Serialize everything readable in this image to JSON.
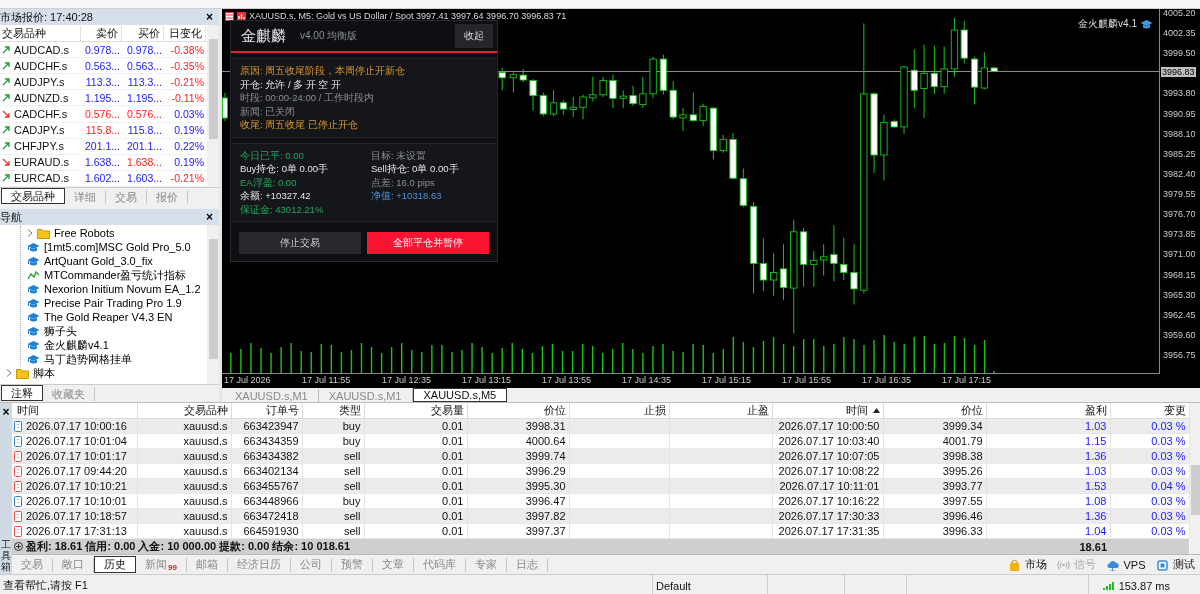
{
  "market_watch": {
    "title": "市场报价: 17:40:28",
    "close_button": "×",
    "columns": [
      "交易品种",
      "卖价",
      "买价",
      "日变化"
    ],
    "rows": [
      {
        "symbol": "AUDCAD.s",
        "direction_up": true,
        "bid": "0.978...",
        "bid_up": true,
        "ask": "0.978...",
        "ask_up": true,
        "change": "-0.38%",
        "change_up": false
      },
      {
        "symbol": "AUDCHF.s",
        "direction_up": true,
        "bid": "0.563...",
        "bid_up": true,
        "ask": "0.563...",
        "ask_up": true,
        "change": "-0.35%",
        "change_up": false
      },
      {
        "symbol": "AUDJPY.s",
        "direction_up": true,
        "bid": "113.3...",
        "bid_up": true,
        "ask": "113.3...",
        "ask_up": true,
        "change": "-0.21%",
        "change_up": false
      },
      {
        "symbol": "AUDNZD.s",
        "direction_up": true,
        "bid": "1.195...",
        "bid_up": true,
        "ask": "1.195...",
        "ask_up": true,
        "change": "-0.11%",
        "change_up": false
      },
      {
        "symbol": "CADCHF.s",
        "direction_up": false,
        "bid": "0.576...",
        "bid_up": false,
        "ask": "0.576...",
        "ask_up": false,
        "change": "0.03%",
        "change_up": true
      },
      {
        "symbol": "CADJPY.s",
        "direction_up": true,
        "bid": "115.8...",
        "bid_up": false,
        "ask": "115.8...",
        "ask_up": true,
        "change": "0.19%",
        "change_up": true
      },
      {
        "symbol": "CHFJPY.s",
        "direction_up": true,
        "bid": "201.1...",
        "bid_up": true,
        "ask": "201.1...",
        "ask_up": true,
        "change": "0.22%",
        "change_up": true
      },
      {
        "symbol": "EURAUD.s",
        "direction_up": false,
        "bid": "1.638...",
        "bid_up": true,
        "ask": "1.638...",
        "ask_up": false,
        "change": "0.19%",
        "change_up": true
      },
      {
        "symbol": "EURCAD.s",
        "direction_up": true,
        "bid": "1.602...",
        "bid_up": true,
        "ask": "1.603...",
        "ask_up": true,
        "change": "-0.21%",
        "change_up": false
      }
    ],
    "tabs": [
      {
        "label": "交易品种",
        "selected": true
      },
      {
        "label": "详细",
        "selected": false
      },
      {
        "label": "交易",
        "selected": false
      },
      {
        "label": "报价",
        "selected": false
      }
    ]
  },
  "navigator": {
    "title": "导航",
    "close_button": "×",
    "tree": [
      {
        "kind": "group",
        "children": [
          {
            "kind": "folder",
            "label": "Free Robots",
            "expanded": false
          },
          {
            "kind": "expert",
            "label": "[1mt5.com]MSC Gold Pro_5.0"
          },
          {
            "kind": "expert",
            "label": "ArtQuant Gold_3.0_fix"
          },
          {
            "kind": "indicator",
            "label": "MTCommander盈亏统计指标"
          },
          {
            "kind": "expert",
            "label": "Nexorion Initium Novum EA_1.2"
          },
          {
            "kind": "expert",
            "label": "Precise Pair Trading Pro 1.9"
          },
          {
            "kind": "expert",
            "label": "The Gold Reaper V4.3 EN"
          },
          {
            "kind": "expert",
            "label": "狮子头"
          },
          {
            "kind": "expert",
            "label": "金火麒麟v4.1"
          },
          {
            "kind": "expert",
            "label": "马丁趋势网格挂单"
          }
        ]
      },
      {
        "kind": "folder",
        "label": "脚本",
        "expanded": false
      }
    ],
    "tabs": [
      {
        "label": "注释",
        "selected": true
      },
      {
        "label": "收藏夹",
        "selected": false
      }
    ]
  },
  "chart": {
    "title": "XAUUSD.s, M5:  Gold vs US Dollar / Spot  3997.41 3997.64 3996.70 3996.83  71",
    "ea_label": "金火麒麟v4.1",
    "price_ticks": [
      "4005.20",
      "4002.35",
      "3999.50",
      "3993.80",
      "3990.95",
      "3988.10",
      "3985.25",
      "3982.40",
      "3979.55",
      "3976.70",
      "3973.85",
      "3971.00",
      "3968.15",
      "3965.30",
      "3962.45",
      "3959.60",
      "3956.75"
    ],
    "current_price": "3996.83",
    "time_ticks": [
      "17 Jul 2026",
      "17 Jul 11:55",
      "17 Jul 12:35",
      "17 Jul 13:15",
      "17 Jul 13:55",
      "17 Jul 14:35",
      "17 Jul 15:15",
      "17 Jul 15:55",
      "17 Jul 16:35",
      "17 Jul 17:15"
    ],
    "tabs": [
      {
        "label": "XAUUSD.s,M1",
        "selected": false
      },
      {
        "label": "XAUUSD.s,M1",
        "selected": false
      },
      {
        "label": "XAUUSD.s,M5",
        "selected": true
      }
    ]
  },
  "ea_panel": {
    "title": "金麒麟",
    "version": "v4.00 均衡版",
    "collapse_button": "收起",
    "status_lines": [
      {
        "label": "原因:",
        "value": "周五收尾阶段，本周停止开新仓",
        "alert": true,
        "dimmed": false
      },
      {
        "label": "开仓:",
        "value": "允许  /  多 开  空 开",
        "alert": false,
        "dimmed": false
      },
      {
        "label": "时段:",
        "value": "00:00-24:00  /  工作时段内",
        "alert": false,
        "dimmed": true
      },
      {
        "label": "新闻:",
        "value": "已关闭",
        "alert": false,
        "dimmed": true
      },
      {
        "label": "收尾:",
        "value": "周五收尾 已停止开仓",
        "alert": true,
        "dimmed": false
      }
    ],
    "stats": [
      {
        "label": "今日已平:",
        "value": "0.00",
        "positive": true,
        "dimmed": false,
        "info": false
      },
      {
        "label": "目标:",
        "value": "未设置",
        "positive": false,
        "dimmed": true,
        "info": false
      },
      {
        "label": "Buy持仓:",
        "value": "0单  0.00手",
        "positive": false,
        "dimmed": false,
        "info": false
      },
      {
        "label": "Sell持仓:",
        "value": "0单  0.00手",
        "positive": false,
        "dimmed": false,
        "info": false
      },
      {
        "label": "EA浮盈:",
        "value": "0.00",
        "positive": true,
        "dimmed": false,
        "info": false
      },
      {
        "label": "点差:",
        "value": "16.0 pips",
        "positive": false,
        "dimmed": true,
        "info": false
      },
      {
        "label": "余额:",
        "value": "+10327.42",
        "positive": false,
        "dimmed": false,
        "info": false
      },
      {
        "label": "净值:",
        "value": "+10318.63",
        "positive": false,
        "dimmed": false,
        "info": true
      },
      {
        "label": "保证金:",
        "value": "43012.21%",
        "positive": true,
        "dimmed": false,
        "info": false
      }
    ],
    "buttons": [
      {
        "label": "停止交易",
        "kind": "secondary"
      },
      {
        "label": "全部平仓并暂停",
        "kind": "danger"
      }
    ]
  },
  "terminal": {
    "close_button": "×",
    "side_label": "工具箱",
    "columns": [
      {
        "label": "时间",
        "sorted": false
      },
      {
        "label": "交易品种",
        "sorted": false
      },
      {
        "label": "订单号",
        "sorted": false
      },
      {
        "label": "类型",
        "sorted": false
      },
      {
        "label": "交易量",
        "sorted": false
      },
      {
        "label": "价位",
        "sorted": false
      },
      {
        "label": "止损",
        "sorted": false
      },
      {
        "label": "止盈",
        "sorted": false
      },
      {
        "label": "时间",
        "sorted": true
      },
      {
        "label": "价位",
        "sorted": false
      },
      {
        "label": "盈利",
        "sorted": false
      },
      {
        "label": "变更",
        "sorted": false
      }
    ],
    "rows": [
      {
        "open_time": "2026.07.17 10:00:16",
        "symbol": "xauusd.s",
        "order": "663423947",
        "type": "buy",
        "volume": "0.01",
        "open_price": "3998.31",
        "close_time": "2026.07.17 10:00:50",
        "close_price": "3999.34",
        "profit": "1.03",
        "change": "0.03 %"
      },
      {
        "open_time": "2026.07.17 10:01:04",
        "symbol": "xauusd.s",
        "order": "663434359",
        "type": "buy",
        "volume": "0.01",
        "open_price": "4000.64",
        "close_time": "2026.07.17 10:03:40",
        "close_price": "4001.79",
        "profit": "1.15",
        "change": "0.03 %"
      },
      {
        "open_time": "2026.07.17 10:01:17",
        "symbol": "xauusd.s",
        "order": "663434382",
        "type": "sell",
        "volume": "0.01",
        "open_price": "3999.74",
        "close_time": "2026.07.17 10:07:05",
        "close_price": "3998.38",
        "profit": "1.36",
        "change": "0.03 %"
      },
      {
        "open_time": "2026.07.17 09:44:20",
        "symbol": "xauusd.s",
        "order": "663402134",
        "type": "sell",
        "volume": "0.01",
        "open_price": "3996.29",
        "close_time": "2026.07.17 10:08:22",
        "close_price": "3995.26",
        "profit": "1.03",
        "change": "0.03 %"
      },
      {
        "open_time": "2026.07.17 10:10:21",
        "symbol": "xauusd.s",
        "order": "663455767",
        "type": "sell",
        "volume": "0.01",
        "open_price": "3995.30",
        "close_time": "2026.07.17 10:11:01",
        "close_price": "3993.77",
        "profit": "1.53",
        "change": "0.04 %"
      },
      {
        "open_time": "2026.07.17 10:10:01",
        "symbol": "xauusd.s",
        "order": "663448966",
        "type": "buy",
        "volume": "0.01",
        "open_price": "3996.47",
        "close_time": "2026.07.17 10:16:22",
        "close_price": "3997.55",
        "profit": "1.08",
        "change": "0.03 %"
      },
      {
        "open_time": "2026.07.17 10:18:57",
        "symbol": "xauusd.s",
        "order": "663472418",
        "type": "sell",
        "volume": "0.01",
        "open_price": "3997.82",
        "close_time": "2026.07.17 17:30:33",
        "close_price": "3996.46",
        "profit": "1.36",
        "change": "0.03 %"
      },
      {
        "open_time": "2026.07.17 17:31:13",
        "symbol": "xauusd.s",
        "order": "664591930",
        "type": "sell",
        "volume": "0.01",
        "open_price": "3997.37",
        "close_time": "2026.07.17 17:31:35",
        "close_price": "3996.33",
        "profit": "1.04",
        "change": "0.03 %"
      }
    ],
    "summary": {
      "text": "盈利: 18.61  信用: 0.00  入金: 10 000.00  提款: 0.00  结余: 10 018.61",
      "total": "18.61"
    },
    "tabs": [
      {
        "label": "交易",
        "selected": false
      },
      {
        "label": "敞口",
        "selected": false
      },
      {
        "label": "历史",
        "selected": true
      },
      {
        "label": "新闻",
        "badge": "99",
        "selected": false
      },
      {
        "label": "邮箱",
        "selected": false
      },
      {
        "label": "经济日历",
        "selected": false
      },
      {
        "label": "公司",
        "selected": false
      },
      {
        "label": "预警",
        "selected": false
      },
      {
        "label": "文章",
        "selected": false
      },
      {
        "label": "代码库",
        "selected": false
      },
      {
        "label": "专家",
        "selected": false
      },
      {
        "label": "日志",
        "selected": false
      }
    ],
    "links": [
      {
        "label": "市场",
        "kind": "market",
        "disabled": false
      },
      {
        "label": "信号",
        "kind": "signal",
        "disabled": true
      },
      {
        "label": "VPS",
        "kind": "vps",
        "disabled": false
      },
      {
        "label": "测试",
        "kind": "tester",
        "disabled": false
      }
    ]
  },
  "status_bar": {
    "help": "查看帮忙,请按 F1",
    "profile": "Default",
    "ping": "153.87 ms"
  }
}
